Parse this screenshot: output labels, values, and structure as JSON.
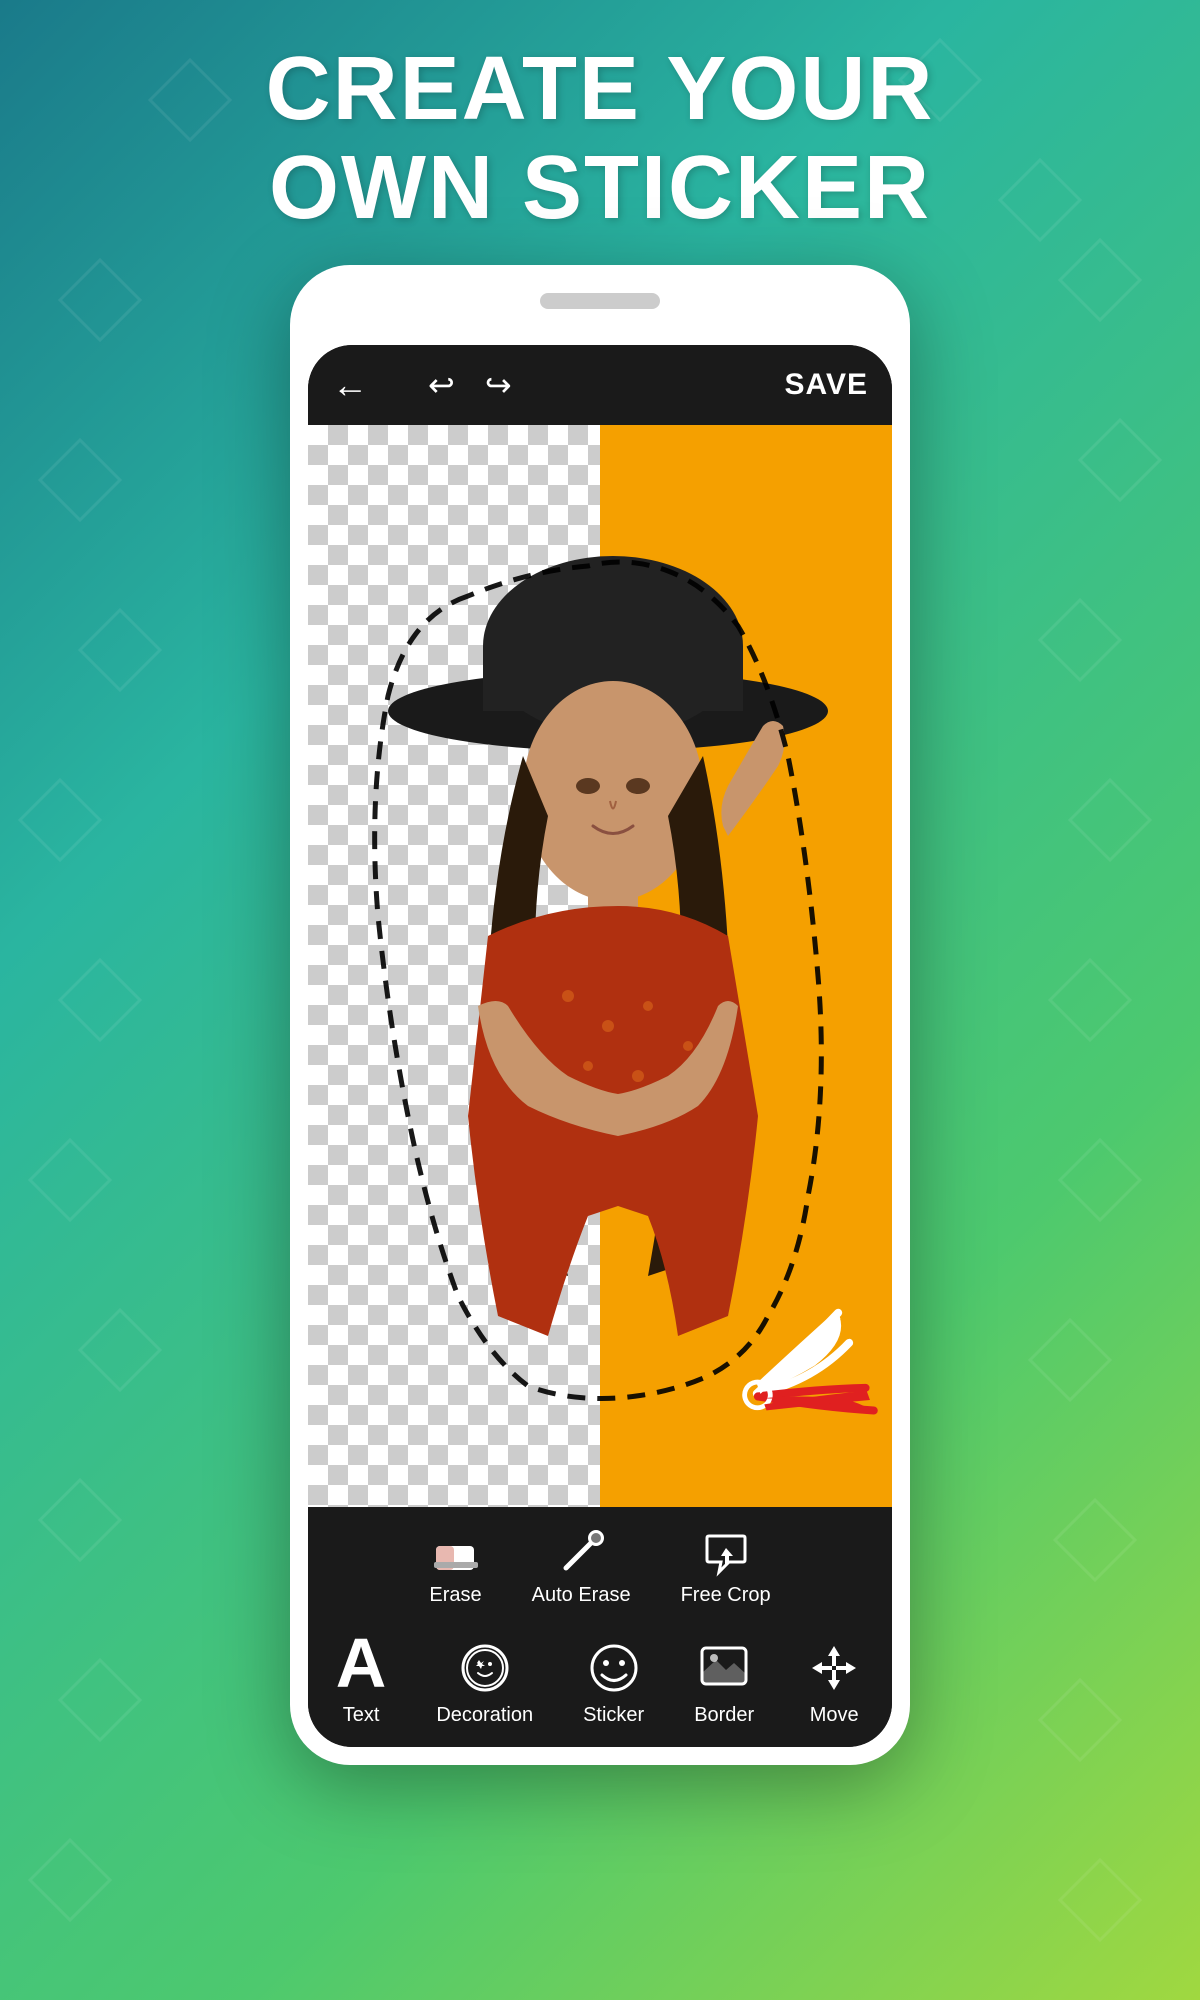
{
  "headline": {
    "line1": "CREATE YOUR",
    "line2": "OWN STICKER"
  },
  "toolbar": {
    "back_icon": "←",
    "undo_icon": "↩",
    "redo_icon": "↪",
    "save_label": "SAVE"
  },
  "tools_row1": [
    {
      "id": "erase",
      "label": "Erase",
      "icon": "eraser"
    },
    {
      "id": "auto-erase",
      "label": "Auto Erase",
      "icon": "brush"
    },
    {
      "id": "free-crop",
      "label": "Free Crop",
      "icon": "lasso"
    }
  ],
  "tools_row2": [
    {
      "id": "text",
      "label": "Text",
      "icon": "A"
    },
    {
      "id": "decoration",
      "label": "Decoration",
      "icon": "decoration"
    },
    {
      "id": "sticker",
      "label": "Sticker",
      "icon": "sticker"
    },
    {
      "id": "border",
      "label": "Border",
      "icon": "border"
    },
    {
      "id": "move",
      "label": "Move",
      "icon": "move"
    }
  ],
  "colors": {
    "background_from": "#1a7a8a",
    "background_to": "#a0d840",
    "orange_panel": "#f5a000",
    "toolbar_bg": "#1a1a1a"
  }
}
